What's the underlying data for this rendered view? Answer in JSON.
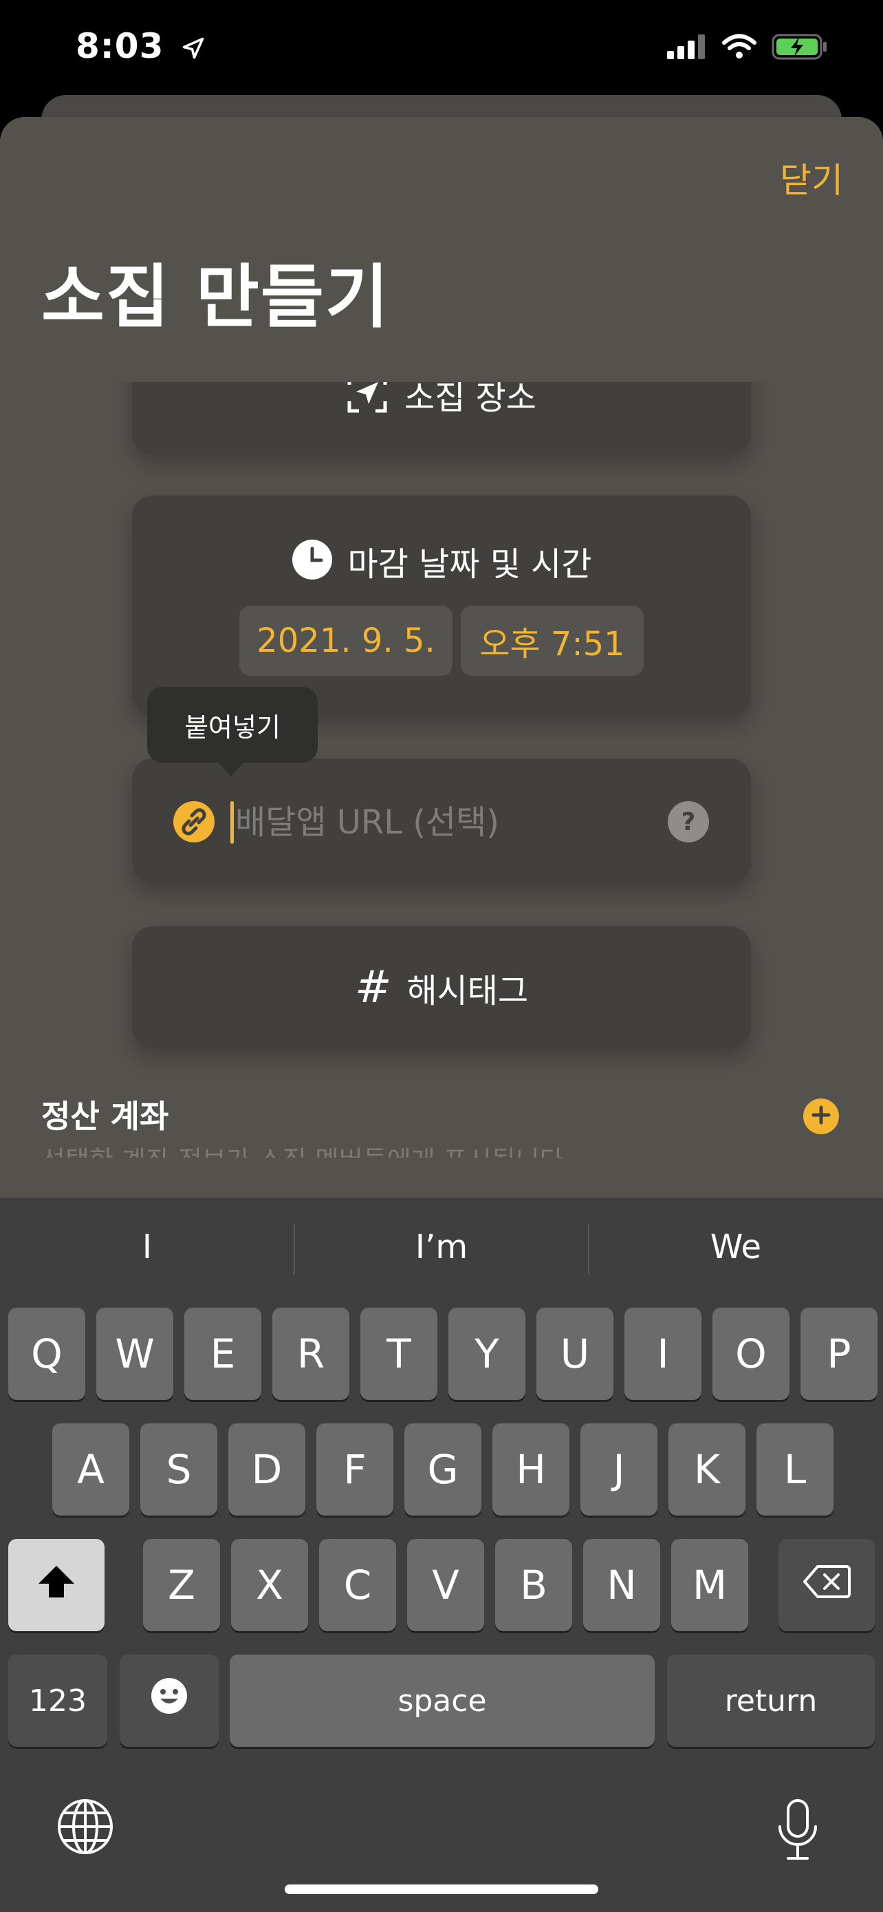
{
  "status": {
    "time": "8:03"
  },
  "header": {
    "close_label": "닫기",
    "title": "소집 만들기"
  },
  "location_card": {
    "label": "소집 장소"
  },
  "deadline_card": {
    "label": "마감 날짜 및 시간",
    "date": "2021. 9. 5.",
    "time": "오후 7:51"
  },
  "tooltip": {
    "label": "붙여넣기"
  },
  "url_field": {
    "placeholder": "배달앱 URL (선택)",
    "help": "?"
  },
  "hashtag_card": {
    "label": "해시태그",
    "symbol": "#"
  },
  "account_section": {
    "title": "정산 계좌",
    "subtitle": "선택한 계좌 정보가 소집 멤버들에게 표시됩니다"
  },
  "keyboard": {
    "suggestions": [
      "I",
      "I’m",
      "We"
    ],
    "row1": [
      "Q",
      "W",
      "E",
      "R",
      "T",
      "Y",
      "U",
      "I",
      "O",
      "P"
    ],
    "row2": [
      "A",
      "S",
      "D",
      "F",
      "G",
      "H",
      "J",
      "K",
      "L"
    ],
    "row3": [
      "Z",
      "X",
      "C",
      "V",
      "B",
      "N",
      "M"
    ],
    "numbers_label": "123",
    "space_label": "space",
    "return_label": "return"
  },
  "colors": {
    "accent": "#f2b431",
    "sheet": "#54524d",
    "card": "#41403d"
  }
}
